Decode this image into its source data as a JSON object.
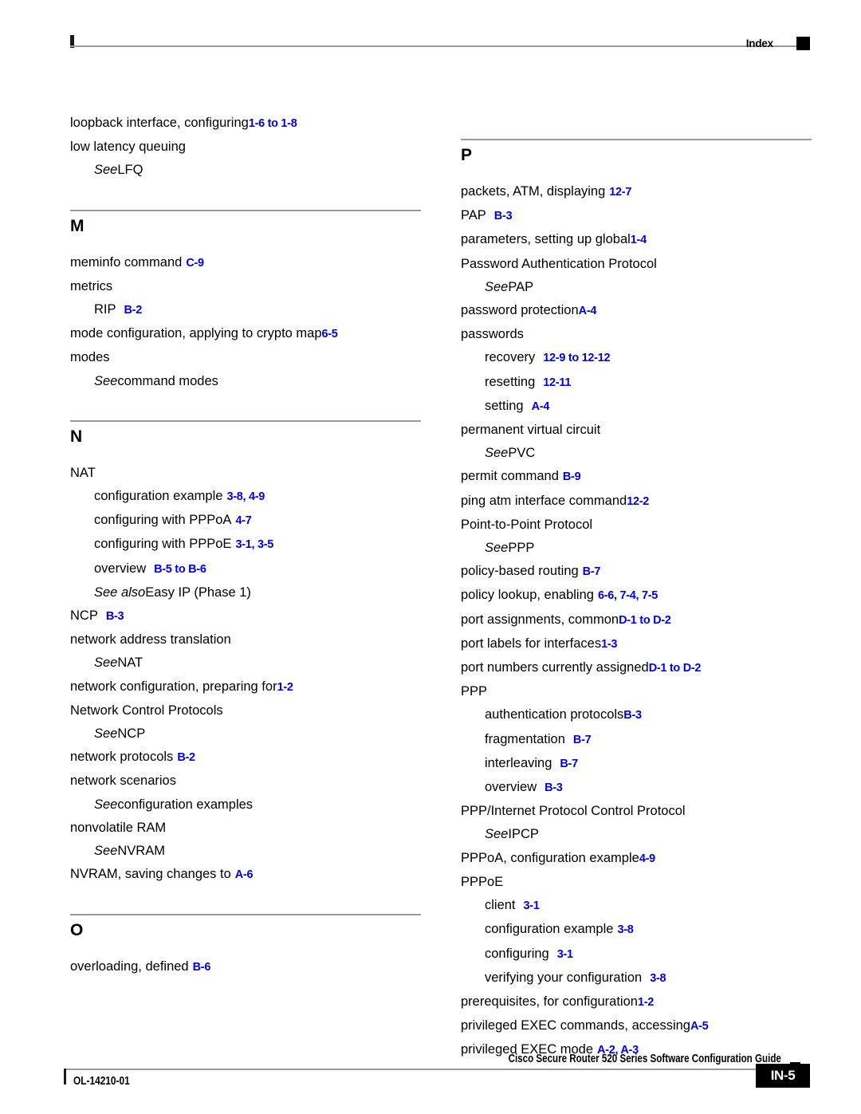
{
  "header": {
    "label": "Index",
    "marker_icon": "black-square-icon"
  },
  "footer": {
    "title": "Cisco Secure Router 520 Series Software Configuration Guide",
    "doc_id": "OL-14210-01",
    "page_number": "IN-5",
    "marker_icon": "black-square-icon"
  },
  "colors": {
    "page_ref_blue": "#0000ee",
    "rule_gray": "#9a9a9a",
    "text_black": "#000000"
  },
  "columns": [
    {
      "name": "left-column",
      "blocks": [
        {
          "type": "entries",
          "entries": [
            {
              "level": 0,
              "text": "loopback interface, configuring",
              "gap": "none",
              "pages": "1-6 to 1-8"
            },
            {
              "level": 0,
              "text": "low latency queuing",
              "gap": "none",
              "pages": ""
            },
            {
              "level": 1,
              "see": "See",
              "text": "LFQ",
              "gap": "none",
              "pages": ""
            }
          ]
        },
        {
          "type": "letter",
          "letter": "M",
          "entries": [
            {
              "level": 0,
              "text": "meminfo command",
              "gap": "sm",
              "pages": "C-9"
            },
            {
              "level": 0,
              "text": "metrics",
              "gap": "none",
              "pages": ""
            },
            {
              "level": 1,
              "text": "RIP",
              "gap": "md",
              "pages": "B-2"
            },
            {
              "level": 0,
              "text": "mode configuration, applying to crypto map",
              "gap": "none",
              "pages": "6-5"
            },
            {
              "level": 0,
              "text": "modes",
              "gap": "none",
              "pages": ""
            },
            {
              "level": 1,
              "see": "See",
              "text": "command modes",
              "gap": "none",
              "pages": ""
            }
          ]
        },
        {
          "type": "letter",
          "letter": "N",
          "entries": [
            {
              "level": 0,
              "text": "NAT",
              "gap": "none",
              "pages": ""
            },
            {
              "level": 1,
              "text": "configuration example",
              "gap": "sm",
              "pages": "3-8, 4-9"
            },
            {
              "level": 1,
              "text": "configuring with PPPoA",
              "gap": "sm",
              "pages": "4-7"
            },
            {
              "level": 1,
              "text": "configuring with PPPoE",
              "gap": "sm",
              "pages": "3-1, 3-5"
            },
            {
              "level": 1,
              "text": "overview",
              "gap": "md",
              "pages": "B-5 to B-6"
            },
            {
              "level": 1,
              "see": "See also",
              "text": "Easy IP (Phase 1)",
              "gap": "none",
              "pages": ""
            },
            {
              "level": 0,
              "text": "NCP",
              "gap": "md",
              "pages": "B-3"
            },
            {
              "level": 0,
              "text": "network address translation",
              "gap": "none",
              "pages": ""
            },
            {
              "level": 1,
              "see": "See",
              "text": "NAT",
              "gap": "none",
              "pages": ""
            },
            {
              "level": 0,
              "text": "network configuration, preparing for",
              "gap": "none",
              "pages": "1-2"
            },
            {
              "level": 0,
              "text": "Network Control Protocols",
              "gap": "none",
              "pages": ""
            },
            {
              "level": 1,
              "see": "See",
              "text": "NCP",
              "gap": "none",
              "pages": ""
            },
            {
              "level": 0,
              "text": "network protocols",
              "gap": "sm",
              "pages": "B-2"
            },
            {
              "level": 0,
              "text": "network scenarios",
              "gap": "none",
              "pages": ""
            },
            {
              "level": 1,
              "see": "See",
              "text": "configuration examples",
              "gap": "none",
              "pages": ""
            },
            {
              "level": 0,
              "text": "nonvolatile RAM",
              "gap": "none",
              "pages": ""
            },
            {
              "level": 1,
              "see": "See",
              "text": "NVRAM",
              "gap": "none",
              "pages": ""
            },
            {
              "level": 0,
              "text": "NVRAM, saving changes to",
              "gap": "sm",
              "pages": "A-6"
            }
          ]
        },
        {
          "type": "letter",
          "letter": "O",
          "entries": [
            {
              "level": 0,
              "text": "overloading, defined",
              "gap": "sm",
              "pages": "B-6"
            }
          ]
        }
      ]
    },
    {
      "name": "right-column",
      "blocks": [
        {
          "type": "letter",
          "letter": "P",
          "entries": [
            {
              "level": 0,
              "text": "packets, ATM, displaying",
              "gap": "sm",
              "pages": "12-7"
            },
            {
              "level": 0,
              "text": "PAP",
              "gap": "md",
              "pages": "B-3"
            },
            {
              "level": 0,
              "text": "parameters, setting up global",
              "gap": "none",
              "pages": "1-4"
            },
            {
              "level": 0,
              "text": "Password Authentication Protocol",
              "gap": "none",
              "pages": ""
            },
            {
              "level": 1,
              "see": "See",
              "text": "PAP",
              "gap": "none",
              "pages": ""
            },
            {
              "level": 0,
              "text": "password protection",
              "gap": "none",
              "pages": "A-4"
            },
            {
              "level": 0,
              "text": "passwords",
              "gap": "none",
              "pages": ""
            },
            {
              "level": 1,
              "text": "recovery",
              "gap": "md",
              "pages": "12-9 to 12-12"
            },
            {
              "level": 1,
              "text": "resetting",
              "gap": "md",
              "pages": "12-11"
            },
            {
              "level": 1,
              "text": "setting",
              "gap": "md",
              "pages": "A-4"
            },
            {
              "level": 0,
              "text": "permanent virtual circuit",
              "gap": "none",
              "pages": ""
            },
            {
              "level": 1,
              "see": "See",
              "text": "PVC",
              "gap": "none",
              "pages": ""
            },
            {
              "level": 0,
              "text": "permit command",
              "gap": "sm",
              "pages": "B-9"
            },
            {
              "level": 0,
              "text": "ping atm interface command",
              "gap": "none",
              "pages": "12-2"
            },
            {
              "level": 0,
              "text": "Point-to-Point Protocol",
              "gap": "none",
              "pages": ""
            },
            {
              "level": 1,
              "see": "See",
              "text": "PPP",
              "gap": "none",
              "pages": ""
            },
            {
              "level": 0,
              "text": "policy-based routing",
              "gap": "sm",
              "pages": "B-7"
            },
            {
              "level": 0,
              "text": "policy lookup, enabling",
              "gap": "sm",
              "pages": "6-6, 7-4, 7-5"
            },
            {
              "level": 0,
              "text": "port assignments, common",
              "gap": "none",
              "pages": "D-1 to D-2"
            },
            {
              "level": 0,
              "text": "port labels for interfaces",
              "gap": "none",
              "pages": "1-3"
            },
            {
              "level": 0,
              "text": "port numbers currently assigned",
              "gap": "none",
              "pages": "D-1 to D-2"
            },
            {
              "level": 0,
              "text": "PPP",
              "gap": "none",
              "pages": ""
            },
            {
              "level": 1,
              "text": "authentication protocols",
              "gap": "none",
              "pages": "B-3"
            },
            {
              "level": 1,
              "text": "fragmentation",
              "gap": "md",
              "pages": "B-7"
            },
            {
              "level": 1,
              "text": "interleaving",
              "gap": "md",
              "pages": "B-7"
            },
            {
              "level": 1,
              "text": "overview",
              "gap": "md",
              "pages": "B-3"
            },
            {
              "level": 0,
              "text": "PPP/Internet Protocol Control Protocol",
              "gap": "none",
              "pages": ""
            },
            {
              "level": 1,
              "see": "See",
              "text": "IPCP",
              "gap": "none",
              "pages": ""
            },
            {
              "level": 0,
              "text": "PPPoA, configuration example",
              "gap": "none",
              "pages": "4-9"
            },
            {
              "level": 0,
              "text": "PPPoE",
              "gap": "none",
              "pages": ""
            },
            {
              "level": 1,
              "text": "client",
              "gap": "md",
              "pages": "3-1"
            },
            {
              "level": 1,
              "text": "configuration example",
              "gap": "sm",
              "pages": "3-8"
            },
            {
              "level": 1,
              "text": "configuring",
              "gap": "md",
              "pages": "3-1"
            },
            {
              "level": 1,
              "text": "verifying your configuration",
              "gap": "md",
              "pages": "3-8"
            },
            {
              "level": 0,
              "text": "prerequisites, for configuration",
              "gap": "none",
              "pages": "1-2"
            },
            {
              "level": 0,
              "text": "privileged EXEC commands, accessing",
              "gap": "none",
              "pages": "A-5"
            },
            {
              "level": 0,
              "text": "privileged EXEC mode",
              "gap": "sm",
              "pages": "A-2, A-3"
            }
          ]
        }
      ]
    }
  ]
}
